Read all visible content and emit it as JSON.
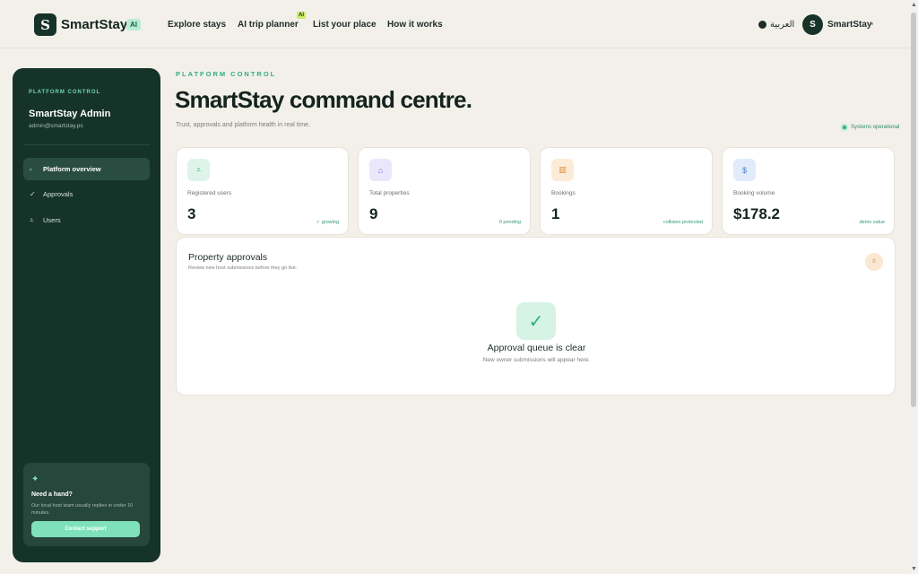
{
  "header": {
    "logo_letter": "S",
    "brand": "SmartStay",
    "brand_badge": "AI",
    "nav": [
      {
        "label": "Explore stays"
      },
      {
        "label": "AI trip planner",
        "badge": "AI"
      },
      {
        "label": "List your place"
      },
      {
        "label": "How it works"
      }
    ],
    "language": "العربية",
    "user_initial": "S",
    "user_name": "SmartStay"
  },
  "sidebar": {
    "eyebrow": "PLATFORM CONTROL",
    "admin_name": "SmartStay Admin",
    "admin_email": "admin@smartstay.ps",
    "items": [
      {
        "label": "Platform overview",
        "icon": "dash-icon",
        "glyph": "-",
        "active": true
      },
      {
        "label": "Approvals",
        "icon": "check-icon",
        "glyph": "✓",
        "active": false
      },
      {
        "label": "Users",
        "icon": "user-icon",
        "glyph": "⩡",
        "active": false
      }
    ],
    "help": {
      "title": "Need a hand?",
      "text": "Our local host team usually replies in under 10 minutes.",
      "button": "Contact support"
    }
  },
  "main": {
    "eyebrow": "PLATFORM CONTROL",
    "title": "SmartStay command centre.",
    "subtitle": "Trust, approvals and platform health in real time.",
    "status": "Systems operational",
    "stats": [
      {
        "label": "Registered users",
        "value": "3",
        "note": "✓ growing",
        "icon": "user-icon",
        "glyph": "⩡",
        "color": "#2fae82",
        "bg": "#dff3ea"
      },
      {
        "label": "Total properties",
        "value": "9",
        "note": "0 pending",
        "icon": "home-icon",
        "glyph": "⌂",
        "color": "#7b6bd6",
        "bg": "#ebe7fb"
      },
      {
        "label": "Bookings",
        "value": "1",
        "note": "collision protected",
        "icon": "calendar-icon",
        "glyph": "▥",
        "color": "#d9903f",
        "bg": "#fcebd6"
      },
      {
        "label": "Booking volume",
        "value": "$178.2",
        "note": "demo value",
        "icon": "dollar-icon",
        "glyph": "$",
        "color": "#4a7fd0",
        "bg": "#e1ebf9"
      }
    ],
    "approvals": {
      "title": "Property approvals",
      "subtitle": "Review new host submissions before they go live.",
      "count": "0",
      "empty_glyph": "✓",
      "empty_title": "Approval queue is clear",
      "empty_subtitle": "New owner submissions will appear here."
    }
  },
  "colors": {
    "accent": "#2fae82",
    "sidebar_bg": "#16332a",
    "page_bg": "#f3f0ea"
  }
}
